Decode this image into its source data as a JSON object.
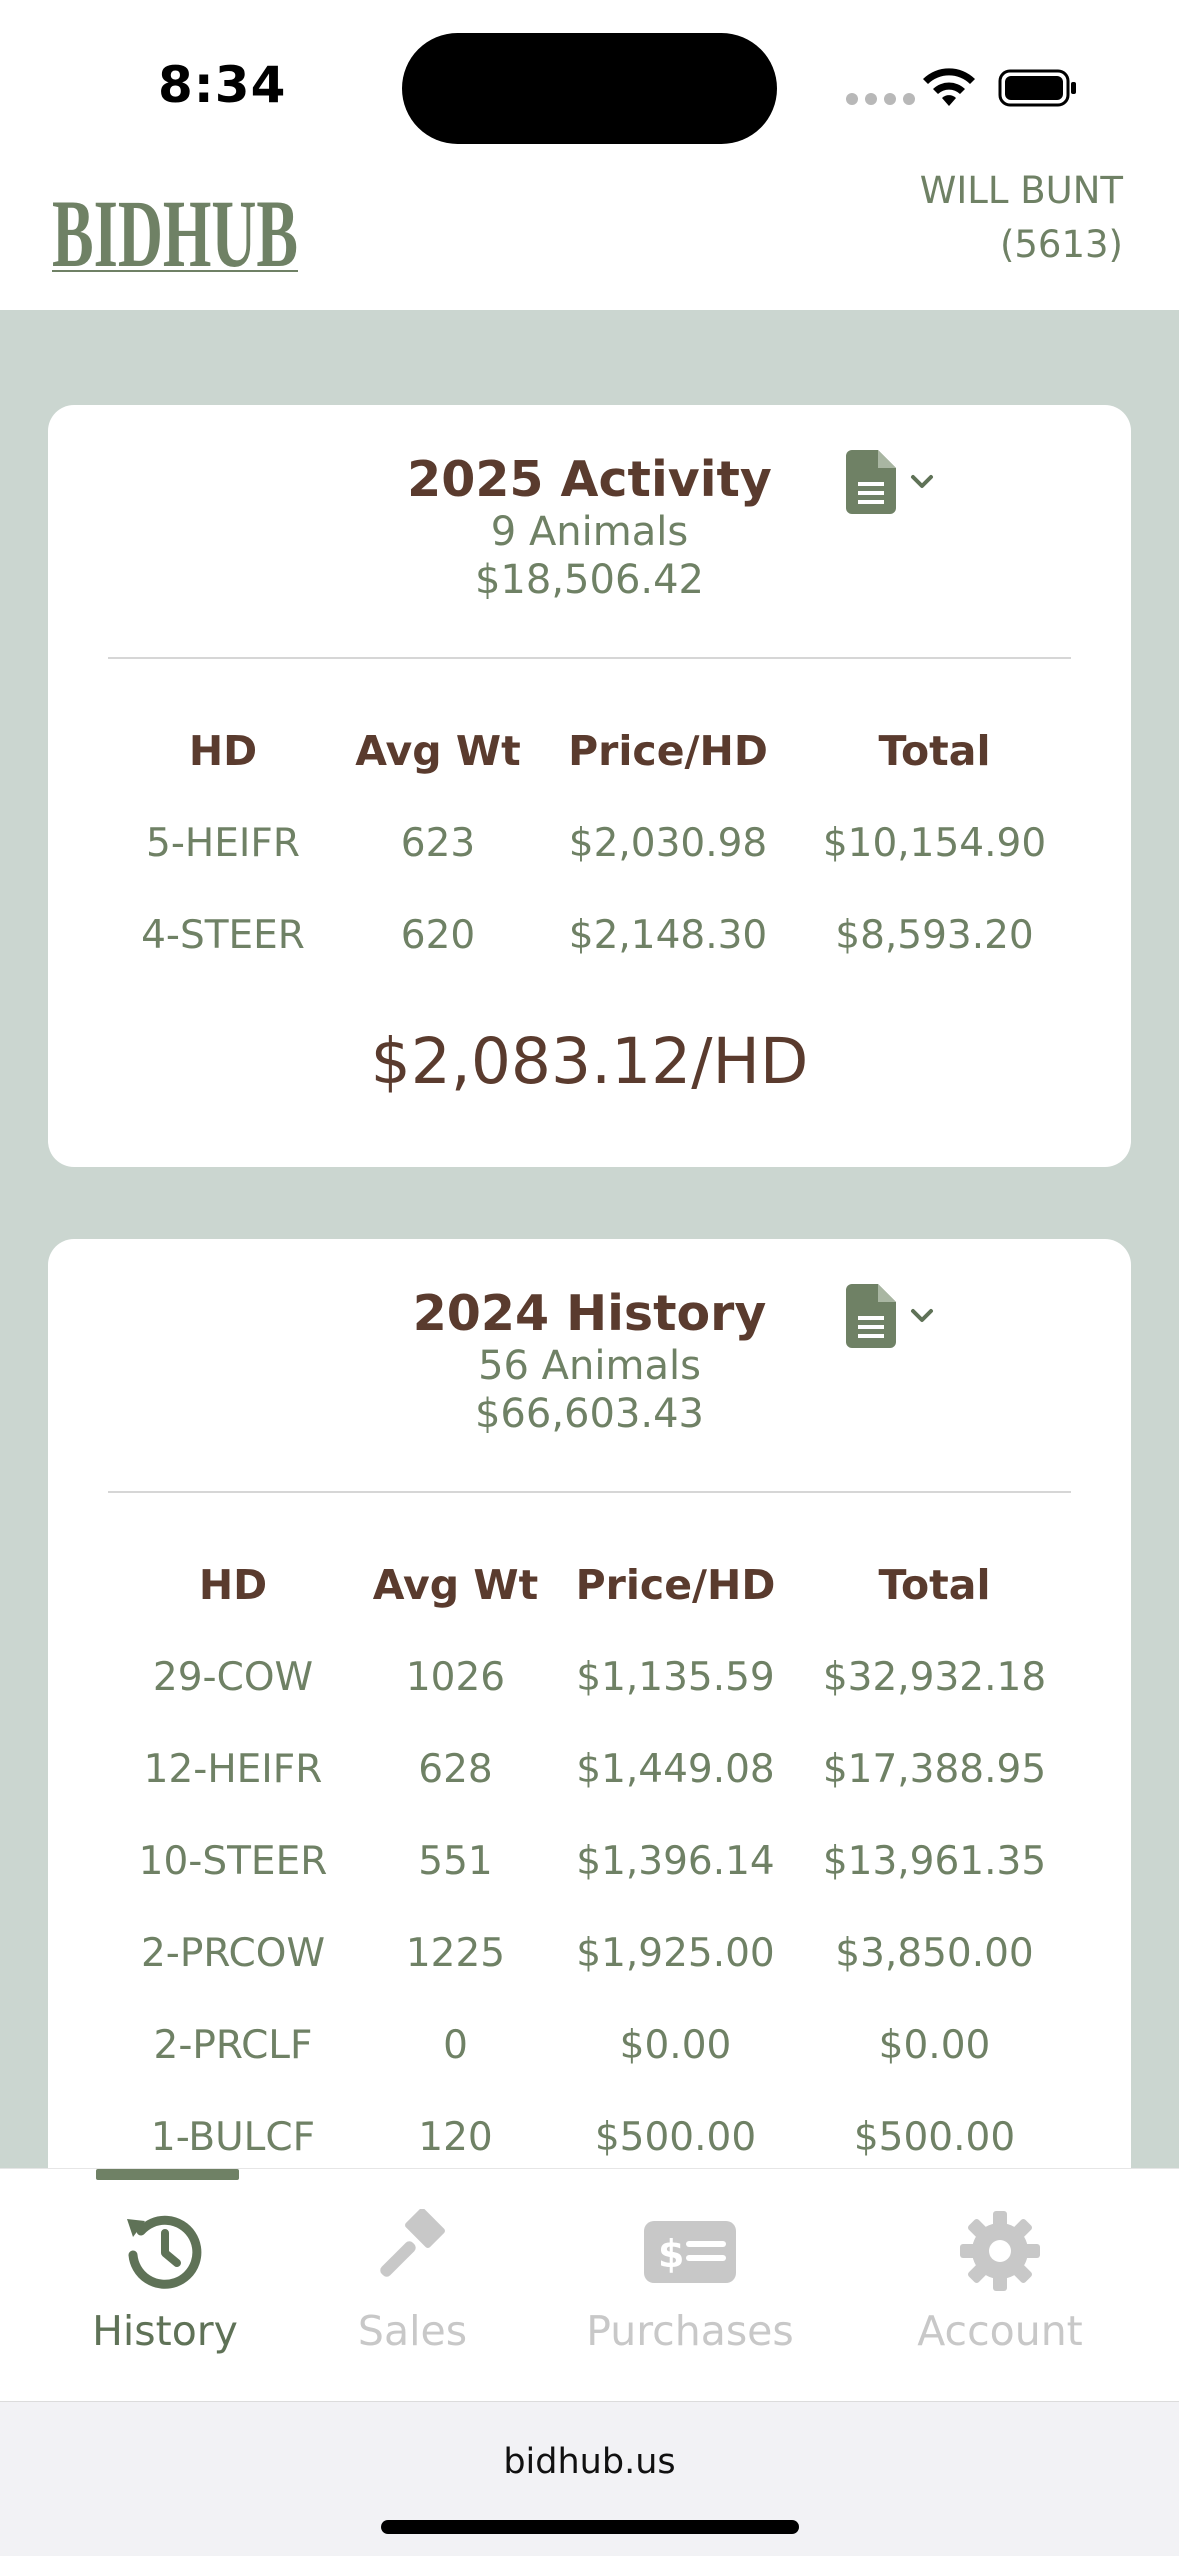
{
  "status_bar": {
    "time": "8:34"
  },
  "header": {
    "logo_text": "BIDHUB",
    "user_name": "WILL BUNT",
    "user_id": "(5613)"
  },
  "cards": [
    {
      "title": "2025 Activity",
      "animals": "9 Animals",
      "amount": "$18,506.42",
      "columns": [
        "HD",
        "Avg Wt",
        "Price/HD",
        "Total"
      ],
      "rows": [
        [
          "5-HEIFR",
          "623",
          "$2,030.98",
          "$10,154.90"
        ],
        [
          "4-STEER",
          "620",
          "$2,148.30",
          "$8,593.20"
        ]
      ],
      "avg_per_hd": "$2,083.12/HD"
    },
    {
      "title": "2024 History",
      "animals": "56 Animals",
      "amount": "$66,603.43",
      "columns": [
        "HD",
        "Avg Wt",
        "Price/HD",
        "Total"
      ],
      "rows": [
        [
          "29-COW",
          "1026",
          "$1,135.59",
          "$32,932.18"
        ],
        [
          "12-HEIFR",
          "628",
          "$1,449.08",
          "$17,388.95"
        ],
        [
          "10-STEER",
          "551",
          "$1,396.14",
          "$13,961.35"
        ],
        [
          "2-PRCOW",
          "1225",
          "$1,925.00",
          "$3,850.00"
        ],
        [
          "2-PRCLF",
          "0",
          "$0.00",
          "$0.00"
        ],
        [
          "1-BULCF",
          "120",
          "$500.00",
          "$500.00"
        ]
      ]
    }
  ],
  "tabs": [
    {
      "label": "History",
      "icon": "history-icon",
      "active": true
    },
    {
      "label": "Sales",
      "icon": "gavel-icon",
      "active": false
    },
    {
      "label": "Purchases",
      "icon": "money-bill-icon",
      "active": false
    },
    {
      "label": "Account",
      "icon": "gear-icon",
      "active": false
    }
  ],
  "browser": {
    "url": "bidhub.us"
  },
  "colors": {
    "brown": "#5a3b2e",
    "green": "#6f8165",
    "page_bg": "#cbd6d0",
    "inactive": "#c8c8c8"
  }
}
